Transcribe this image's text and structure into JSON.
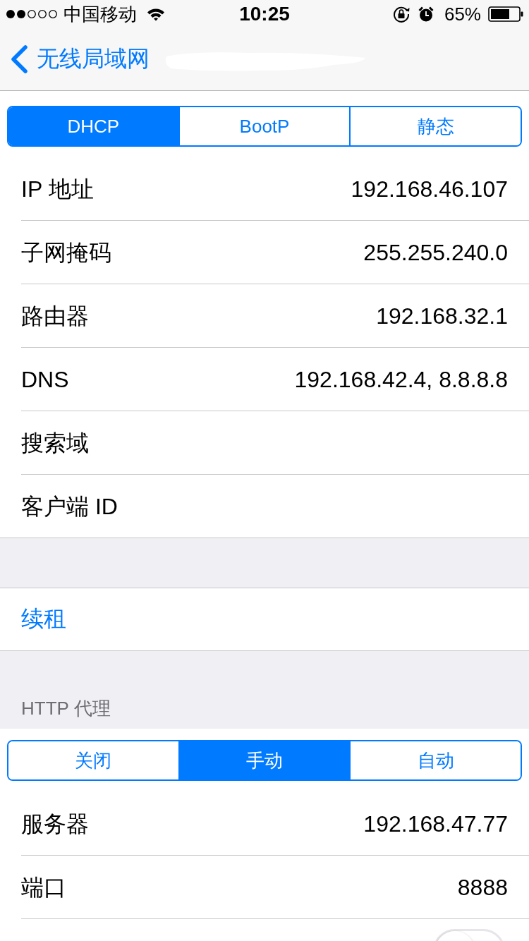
{
  "status_bar": {
    "carrier": "中国移动",
    "time": "10:25",
    "battery": "65%"
  },
  "nav": {
    "back_label": "无线局域网",
    "title_redacted": true
  },
  "ip_mode": {
    "segments": [
      {
        "label": "DHCP",
        "selected": true
      },
      {
        "label": "BootP",
        "selected": false
      },
      {
        "label": "静态",
        "selected": false
      }
    ]
  },
  "ip_rows": [
    {
      "label": "IP 地址",
      "value": "192.168.46.107"
    },
    {
      "label": "子网掩码",
      "value": "255.255.240.0"
    },
    {
      "label": "路由器",
      "value": "192.168.32.1"
    },
    {
      "label": "DNS",
      "value": "192.168.42.4, 8.8.8.8"
    },
    {
      "label": "搜索域"
    },
    {
      "label": "客户端 ID"
    }
  ],
  "renew": {
    "label": "续租"
  },
  "http_proxy": {
    "header": "HTTP 代理",
    "segments": [
      {
        "label": "关闭",
        "selected": false
      },
      {
        "label": "手动",
        "selected": true
      },
      {
        "label": "自动",
        "selected": false
      }
    ],
    "rows": [
      {
        "label": "服务器",
        "value": "192.168.47.77"
      },
      {
        "label": "端口",
        "value": "8888"
      }
    ],
    "auth_switch": {
      "on": false
    }
  }
}
